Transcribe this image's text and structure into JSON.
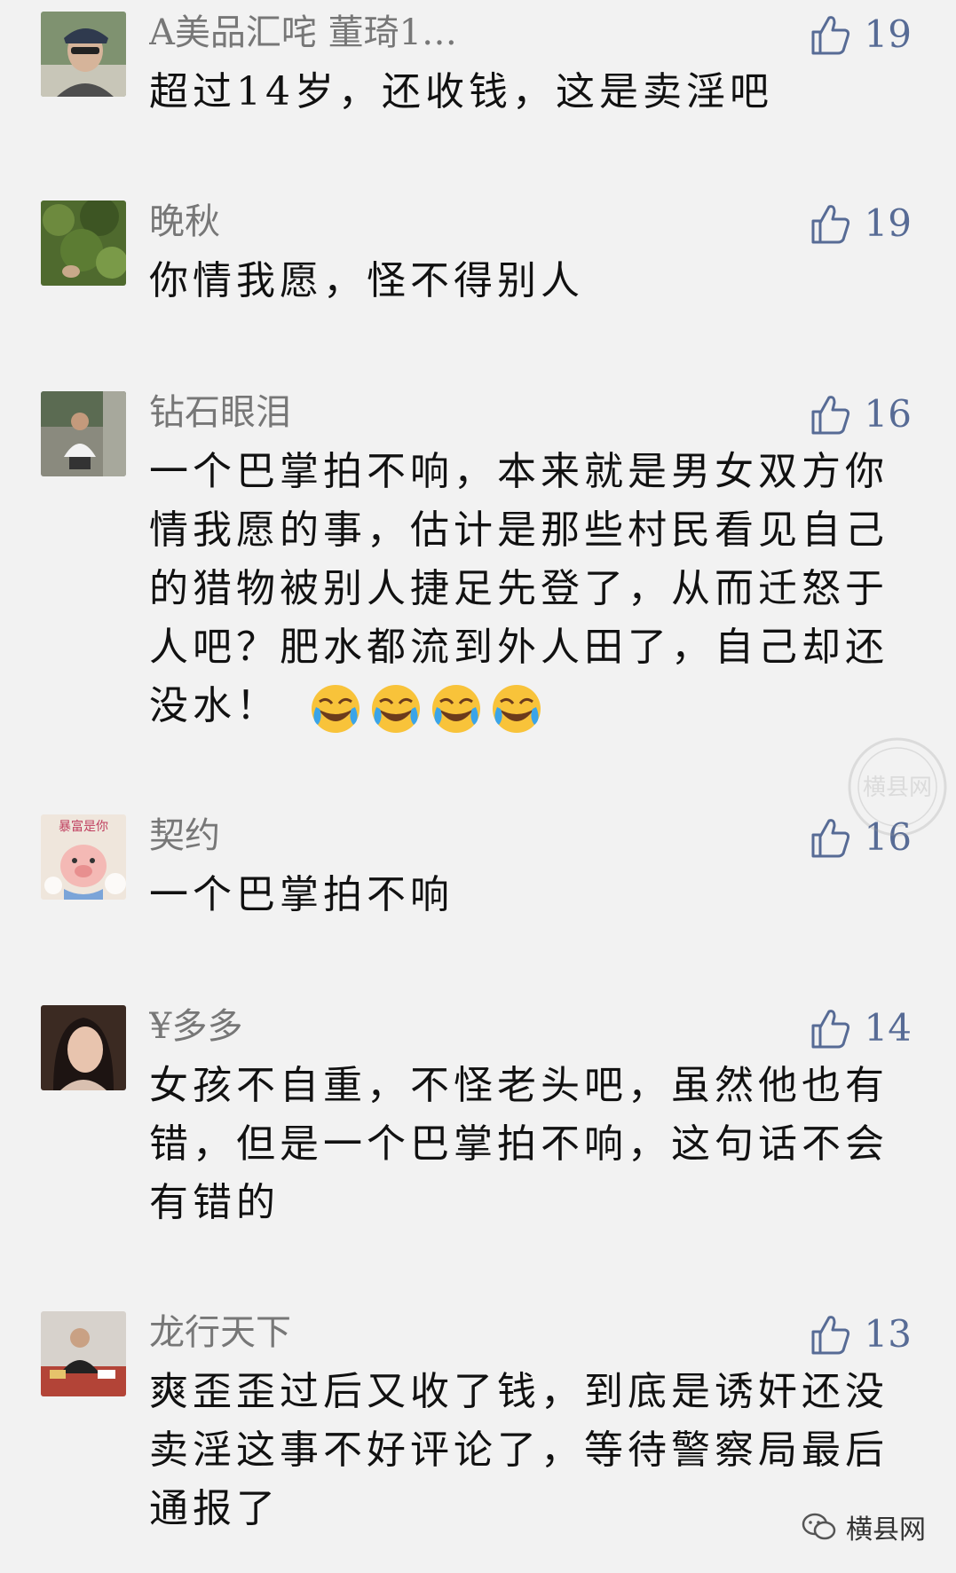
{
  "comments": [
    {
      "name": "A美品汇咤 董琦1…",
      "likes": "19",
      "text": "超过14岁，还收钱，这是卖淫吧"
    },
    {
      "name": "晚秋",
      "likes": "19",
      "text": "你情我愿，怪不得别人"
    },
    {
      "name": "钻石眼泪",
      "likes": "16",
      "text": "一个巴掌拍不响，本来就是男女双方你情我愿的事，估计是那些村民看见自己的猎物被别人捷足先登了，从而迁怒于人吧？肥水都流到外人田了，自己却还没水！",
      "emoji_count": 4,
      "emoji_icon": "face-with-tears-of-joy-icon"
    },
    {
      "name": "契约",
      "likes": "16",
      "text": "一个巴掌拍不响",
      "avatar_caption": "暴富是你"
    },
    {
      "name": "¥多多",
      "likes": "14",
      "text": "女孩不自重，不怪老头吧，虽然他也有错，但是一个巴掌拍不响，这句话不会有错的"
    },
    {
      "name": "龙行天下",
      "likes": "13",
      "text": "爽歪歪过后又收了钱，到底是诱奸还没卖淫这事不好评论了，等待警察局最后通报了"
    }
  ],
  "icons": {
    "like": "thumbs-up-outline-icon",
    "brand": "wechat-bubble-icon"
  },
  "watermark_text": "横县网",
  "brand_label": "横县网",
  "colors": {
    "background": "#f2f2f2",
    "name": "#777777",
    "like": "#576b95",
    "text": "#111111"
  }
}
